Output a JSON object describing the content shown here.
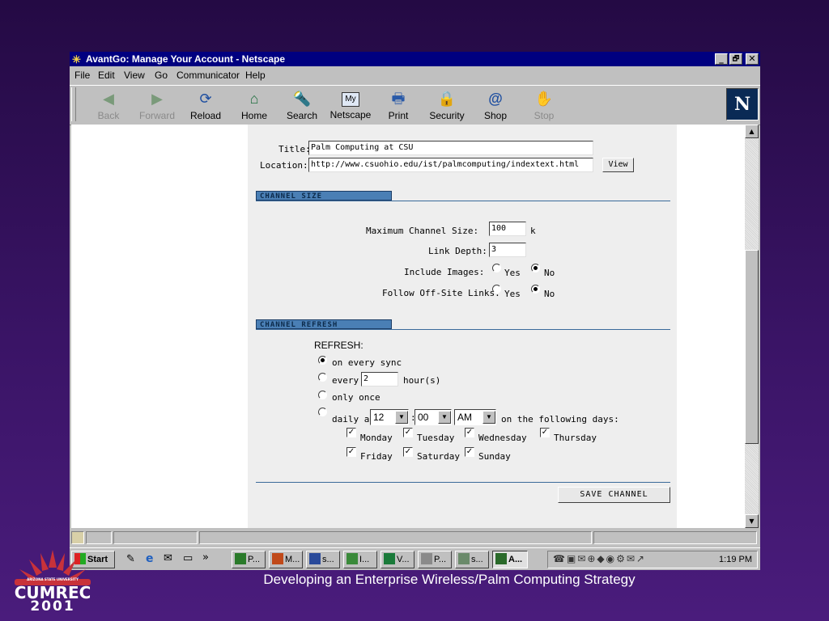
{
  "window": {
    "title": "AvantGo: Manage Your Account - Netscape",
    "controls": {
      "minimize": "_",
      "maximize": "🗗",
      "close": "✕"
    }
  },
  "menu": [
    "File",
    "Edit",
    "View",
    "Go",
    "Communicator",
    "Help"
  ],
  "toolbar": [
    {
      "label": "Back",
      "icon": "◀",
      "enabled": false
    },
    {
      "label": "Forward",
      "icon": "▶",
      "enabled": false
    },
    {
      "label": "Reload",
      "icon": "⟳",
      "enabled": true
    },
    {
      "label": "Home",
      "icon": "⌂",
      "enabled": true
    },
    {
      "label": "Search",
      "icon": "🔦",
      "enabled": true
    },
    {
      "label": "Netscape",
      "icon": "My",
      "enabled": true
    },
    {
      "label": "Print",
      "icon": "🖶",
      "enabled": true
    },
    {
      "label": "Security",
      "icon": "🔒",
      "enabled": true
    },
    {
      "label": "Shop",
      "icon": "@",
      "enabled": true
    },
    {
      "label": "Stop",
      "icon": "✋",
      "enabled": false
    }
  ],
  "netscape_logo": "N",
  "form": {
    "title_label": "Title:",
    "title_value": "Palm Computing at CSU",
    "location_label": "Location:",
    "location_value": "http://www.csuohio.edu/ist/palmcomputing/indextext.html",
    "view_button": "View",
    "channel_size_header": "CHANNEL SIZE",
    "max_size_label": "Maximum Channel Size:",
    "max_size_value": "100",
    "max_size_unit": "k",
    "link_depth_label": "Link Depth:",
    "link_depth_value": "3",
    "include_images_label": "Include Images:",
    "follow_links_label": "Follow Off-Site Links:",
    "yes": "Yes",
    "no": "No",
    "include_images_selected": "No",
    "follow_links_selected": "No",
    "channel_refresh_header": "CHANNEL REFRESH",
    "refresh_label": "REFRESH:",
    "refresh_options": {
      "every_sync": "on every sync",
      "every": "every",
      "every_value": "2",
      "hours": "hour(s)",
      "only_once": "only once",
      "daily_at": "daily at",
      "hour": "12",
      "minute": "00",
      "ampm": "AM",
      "following_days": "on the following days:"
    },
    "refresh_selected": "on every sync",
    "days": [
      {
        "name": "Monday",
        "checked": true
      },
      {
        "name": "Tuesday",
        "checked": true
      },
      {
        "name": "Wednesday",
        "checked": true
      },
      {
        "name": "Thursday",
        "checked": true
      },
      {
        "name": "Friday",
        "checked": true
      },
      {
        "name": "Saturday",
        "checked": true
      },
      {
        "name": "Sunday",
        "checked": true
      }
    ],
    "save_button": "SAVE CHANNEL"
  },
  "taskbar": {
    "start": "Start",
    "chevron": "»",
    "tasks": [
      "P...",
      "M...",
      "s...",
      "I...",
      "V...",
      "P...",
      "s...",
      "A..."
    ],
    "clock": "1:19 PM"
  },
  "slide_caption": "Developing an Enterprise Wireless/Palm Computing Strategy",
  "logo": {
    "arc_text": "ARIZONA STATE UNIVERSITY",
    "name": "CUMREC",
    "year": "2001"
  },
  "colors": {
    "titlebar": "#000080",
    "section_bar": "#4a7fb5",
    "slide_background": "#3a1466",
    "form_background": "#eeeeee"
  }
}
